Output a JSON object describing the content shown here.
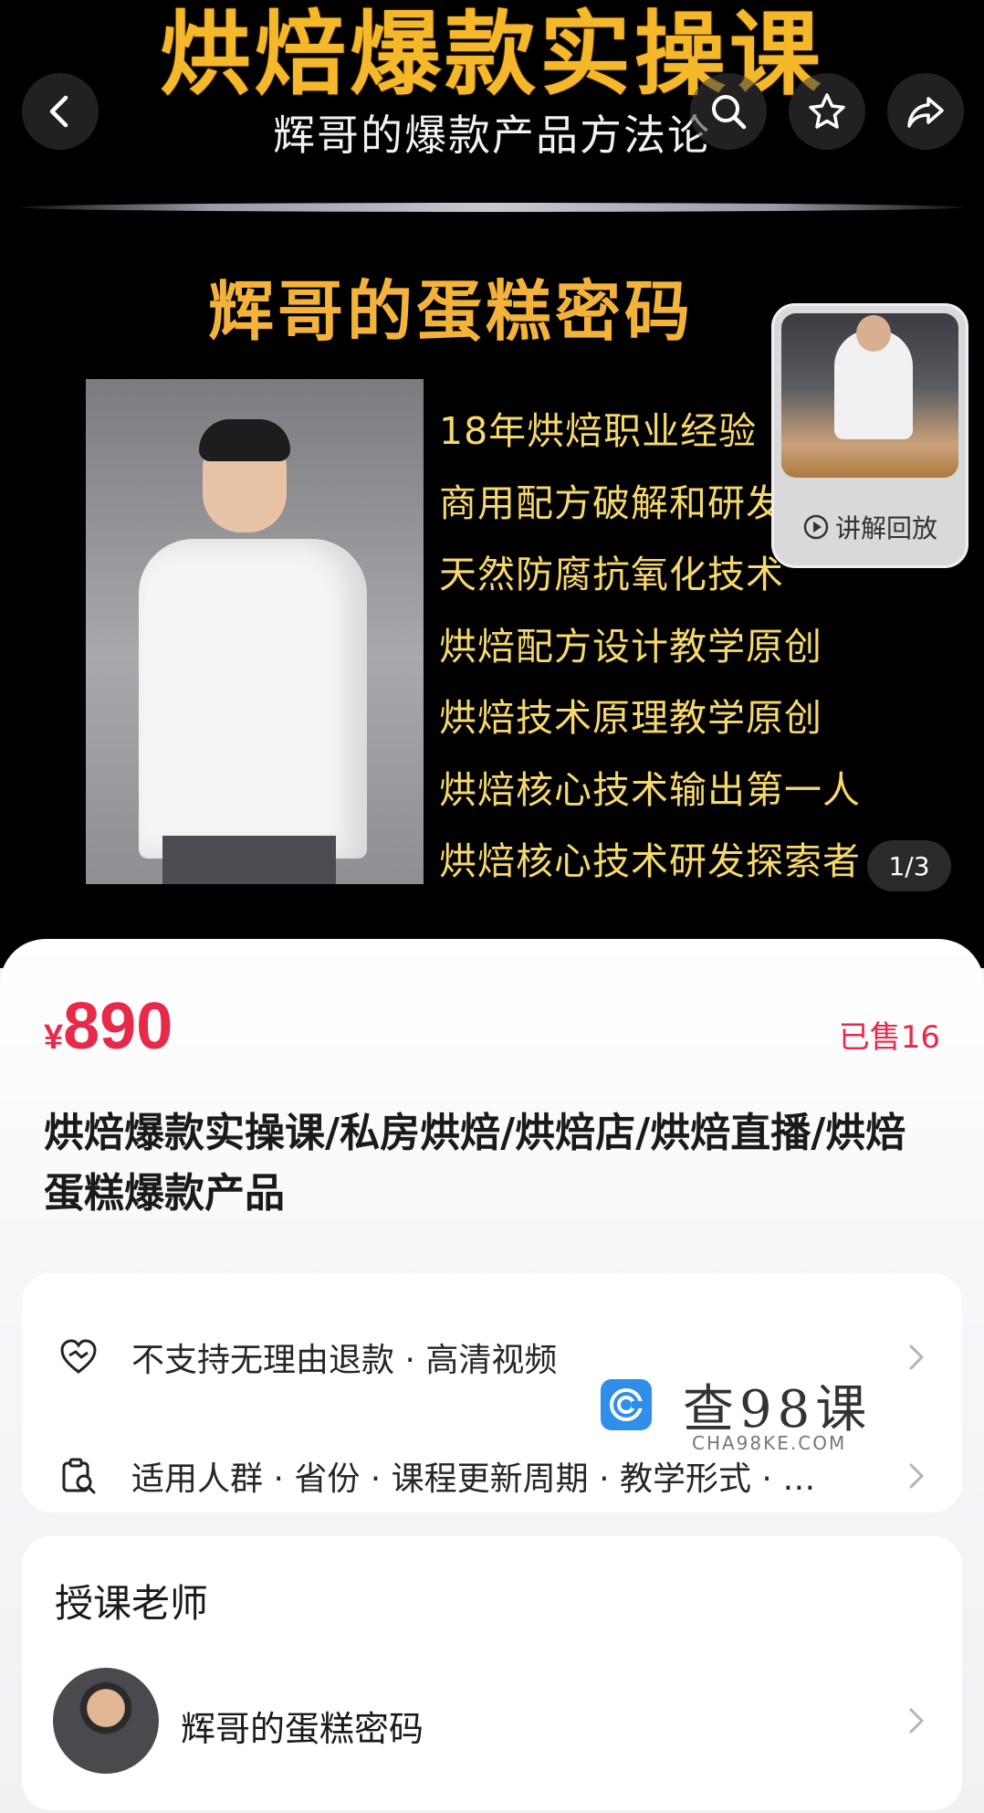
{
  "hero": {
    "title": "烘焙爆款实操课",
    "subtitle": "辉哥的爆款产品方法论",
    "heading": "辉哥的蛋糕密码",
    "credentials": [
      "18年烘焙职业经验",
      "商用配方破解和研发",
      "天然防腐抗氧化技术",
      "烘焙配方设计教学原创",
      "烘焙技术原理教学原创",
      "烘焙核心技术输出第一人",
      "烘焙核心技术研发探索者"
    ],
    "replay_label": "讲解回放",
    "page_indicator": "1/3"
  },
  "toolbar": {
    "back_icon": "chevron-left-icon",
    "search_icon": "search-icon",
    "favorite_icon": "star-icon",
    "share_icon": "share-icon"
  },
  "product": {
    "currency": "¥",
    "price": "890",
    "sold": "已售16",
    "title": "烘焙爆款实操课/私房烘焙/烘焙店/烘焙直播/烘焙蛋糕爆款产品"
  },
  "info_rows": [
    {
      "icon": "heart-refund-icon",
      "text": "不支持无理由退款 · 高清视频"
    },
    {
      "icon": "doc-search-icon",
      "text": "适用人群 · 省份 · 课程更新周期 · 教学形式 · …"
    }
  ],
  "watermark": {
    "text": "查98课",
    "url": "CHA98KE.COM"
  },
  "teacher_section": {
    "title": "授课老师",
    "name": "辉哥的蛋糕密码"
  },
  "colors": {
    "price_red": "#e8294a",
    "hero_gold": "#f5b82a",
    "hero_text": "#f7d86a"
  }
}
